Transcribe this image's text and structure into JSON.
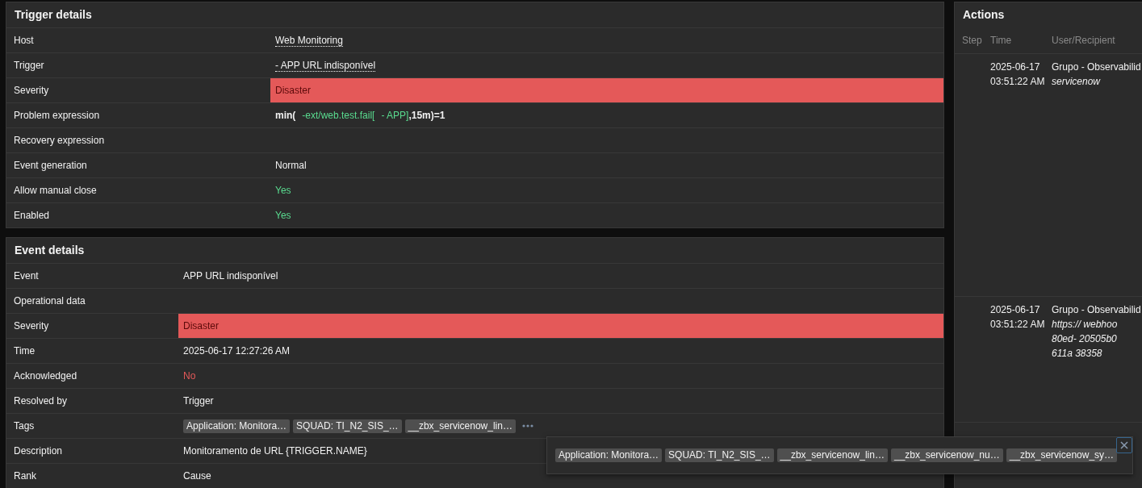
{
  "panels": [
    {
      "kind": "trigger",
      "title": "Trigger details",
      "rows": [
        {
          "label": "Host",
          "kind": "link",
          "value": "Web Monitoring"
        },
        {
          "label": "Trigger",
          "kind": "link",
          "value": "- APP URL indisponível"
        },
        {
          "label": "Severity",
          "kind": "severity",
          "color": "#e45959",
          "value": "Disaster"
        },
        {
          "label": "Problem expression",
          "kind": "expression",
          "parts": [
            {
              "kind": "function",
              "text": "min("
            },
            {
              "kind": "item",
              "text": "-ext/web.test.fail["
            },
            {
              "kind": "item",
              "text": "- APP]"
            },
            {
              "kind": "function",
              "text": ",15m)=1"
            }
          ]
        },
        {
          "label": "Recovery expression",
          "kind": "text"
        },
        {
          "label": "Event generation",
          "kind": "text",
          "value": "Normal"
        },
        {
          "label": "Allow manual close",
          "kind": "good",
          "value": "Yes"
        },
        {
          "label": "Enabled",
          "kind": "good",
          "value": "Yes"
        }
      ]
    },
    {
      "kind": "event",
      "title": "Event details",
      "rows": [
        {
          "label": "Event",
          "kind": "text",
          "value": "APP URL indisponível"
        },
        {
          "label": "Operational data",
          "kind": "text"
        },
        {
          "label": "Severity",
          "kind": "severity",
          "color": "#e45959",
          "value": "Disaster"
        },
        {
          "label": "Time",
          "kind": "text",
          "value": "2025-06-17 12:27:26 AM"
        },
        {
          "label": "Acknowledged",
          "kind": "bad",
          "value": "No"
        },
        {
          "label": "Resolved by",
          "kind": "text",
          "value": "Trigger"
        },
        {
          "label": "Tags",
          "kind": "tags",
          "tags": [
            "Application: Monitora…",
            "SQUAD: TI_N2_SIS_…",
            "__zbx_servicenow_lin…"
          ],
          "more": true
        },
        {
          "label": "Description",
          "kind": "text",
          "value": "Monitoramento de URL {TRIGGER.NAME}"
        },
        {
          "label": "Rank",
          "kind": "text",
          "value": "Cause"
        }
      ]
    }
  ],
  "actions": {
    "title": "Actions",
    "columns": [
      "Step",
      "Time",
      "User/Recipient"
    ],
    "rows": [
      {
        "date": "2025-06-17",
        "time": "03:51:22 AM",
        "user": "Grupo - Observabilid",
        "details": [
          "servicenow"
        ]
      },
      {
        "date": "2025-06-17",
        "time": "03:51:22 AM",
        "user": "Grupo - Observabilid",
        "details": [
          "https:// webhoo",
          "80ed- 20505b0",
          "611a 38358"
        ]
      }
    ]
  },
  "tags_popup": {
    "tags": [
      "Application: Monitora…",
      "SQUAD: TI_N2_SIS_…",
      "__zbx_servicenow_lin…",
      "__zbx_servicenow_nu…",
      "__zbx_servicenow_sy…"
    ]
  }
}
